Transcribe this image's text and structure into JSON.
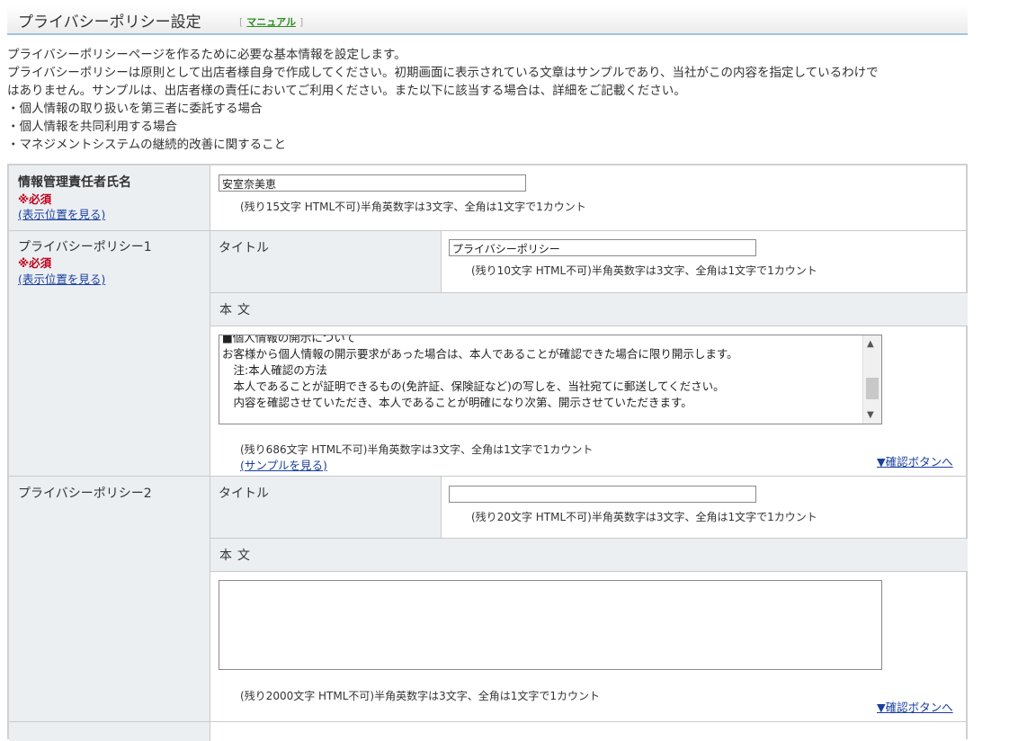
{
  "header": {
    "title": "プライバシーポリシー設定",
    "bracket_open": "[",
    "manual": "マニュアル",
    "bracket_close": "]"
  },
  "intro": [
    "プライバシーポリシーページを作るために必要な基本情報を設定します。",
    "プライバシーポリシーは原則として出店者様自身で作成してください。初期画面に表示されている文章はサンプルであり、当社がこの内容を指定しているわけで",
    "はありません。サンプルは、出店者様の責任においてご利用ください。また以下に該当する場合は、詳細をご記載ください。",
    "・個人情報の取り扱いを第三者に委託する場合",
    "・個人情報を共同利用する場合",
    "・マネジメントシステムの継続的改善に関すること"
  ],
  "manager": {
    "label": "情報管理責任者氏名",
    "required": "※必須",
    "view_position": "(表示位置を見る)",
    "value": "安室奈美恵",
    "note": "(残り15文字 HTML不可)半角英数字は3文字、全角は1文字で1カウント"
  },
  "policy1": {
    "label": "プライバシーポリシー1",
    "required": "※必須",
    "view_position": "(表示位置を見る)",
    "title_label": "タイトル",
    "title_value": "プライバシーポリシー",
    "title_note": "(残り10文字 HTML不可)半角英数字は3文字、全角は1文字で1カウント",
    "body_label": "本文",
    "body_lines": [
      "■個人情報の開示について",
      "お客様から個人情報の開示要求があった場合は、本人であることが確認できた場合に限り開示します。",
      "　注:本人確認の方法",
      "　本人であることが証明できるもの(免許証、保険証など)の写しを、当社宛てに郵送してください。",
      "　内容を確認させていただき、本人であることが明確になり次第、開示させていただきます。"
    ],
    "body_note": "(残り686文字 HTML不可)半角英数字は3文字、全角は1文字で1カウント",
    "sample_link": "(サンプルを見る)",
    "confirm_link": "▼確認ボタンへ"
  },
  "policy2": {
    "label": "プライバシーポリシー2",
    "title_label": "タイトル",
    "title_value": "",
    "title_note": "(残り20文字 HTML不可)半角英数字は3文字、全角は1文字で1カウント",
    "body_label": "本文",
    "body_note": "(残り2000文字 HTML不可)半角英数字は3文字、全角は1文字で1カウント",
    "confirm_link": "▼確認ボタンへ"
  },
  "icons": {
    "scroll_up": "▲",
    "scroll_down": "▼"
  }
}
